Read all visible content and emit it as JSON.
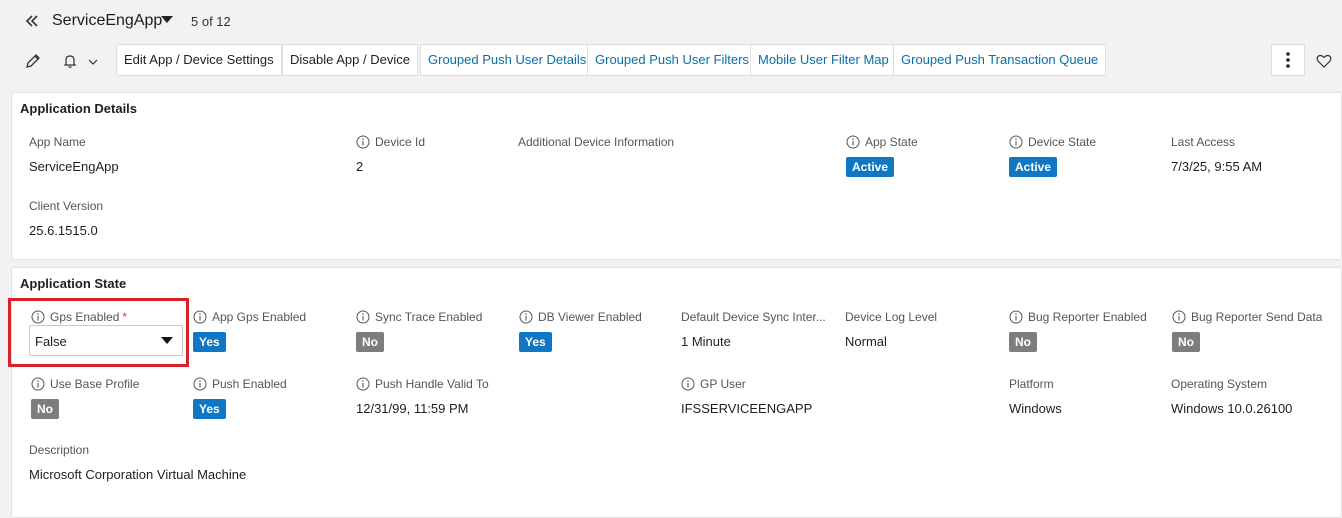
{
  "header": {
    "app_title": "ServiceEngApp",
    "record_counter": "5 of 12"
  },
  "toolbar": {
    "buttons": [
      {
        "label": "Edit App / Device Settings",
        "icon": "none"
      },
      {
        "label": "Disable App / Device",
        "icon": "none"
      }
    ],
    "links": [
      {
        "label": "Grouped Push User Details"
      },
      {
        "label": "Grouped Push User Filters"
      },
      {
        "label": "Mobile User Filter Map"
      },
      {
        "label": "Grouped Push Transaction Queue"
      }
    ],
    "icons": [
      "pencil-icon",
      "bell-icon",
      "chevron-down-icon",
      "more-vertical-icon",
      "heart-icon"
    ]
  },
  "details": {
    "title": "Application Details",
    "app_name": {
      "label": "App Name",
      "value": "ServiceEngApp"
    },
    "device_id": {
      "label": "Device Id",
      "value": "2"
    },
    "additional_info": {
      "label": "Additional Device Information",
      "value": ""
    },
    "app_state": {
      "label": "App State",
      "value": "Active"
    },
    "device_state": {
      "label": "Device State",
      "value": "Active"
    },
    "last_access": {
      "label": "Last Access",
      "value": "7/3/25, 9:55 AM"
    },
    "client_version": {
      "label": "Client Version",
      "value": "25.6.1515.0"
    }
  },
  "state": {
    "title": "Application State",
    "gps_enabled": {
      "label": "Gps Enabled",
      "required_mark": "*",
      "value": "False"
    },
    "app_gps_enabled": {
      "label": "App Gps Enabled",
      "value": "Yes"
    },
    "sync_trace_enabled": {
      "label": "Sync Trace Enabled",
      "value": "No"
    },
    "db_viewer_enabled": {
      "label": "DB Viewer Enabled",
      "value": "Yes"
    },
    "default_sync_interval": {
      "label": "Default Device Sync Inter...",
      "value": "1 Minute"
    },
    "device_log_level": {
      "label": "Device Log Level",
      "value": "Normal"
    },
    "bug_reporter_enabled": {
      "label": "Bug Reporter Enabled",
      "value": "No"
    },
    "bug_reporter_send_data": {
      "label": "Bug Reporter Send Data",
      "value": "No"
    },
    "use_base_profile": {
      "label": "Use Base Profile",
      "value": "No"
    },
    "push_enabled": {
      "label": "Push Enabled",
      "value": "Yes"
    },
    "push_handle_valid_to": {
      "label": "Push Handle Valid To",
      "value": "12/31/99, 11:59 PM"
    },
    "gp_user": {
      "label": "GP User",
      "value": "IFSSERVICEENGAPP"
    },
    "platform": {
      "label": "Platform",
      "value": "Windows"
    },
    "operating_system": {
      "label": "Operating System",
      "value": "Windows 10.0.26100"
    },
    "description": {
      "label": "Description",
      "value": "Microsoft Corporation Virtual Machine"
    }
  },
  "colors": {
    "accent_blue": "#0f77c4",
    "link_blue": "#0a6ea8",
    "badge_grey": "#7d7d7d",
    "highlight_red": "#d9232a"
  }
}
